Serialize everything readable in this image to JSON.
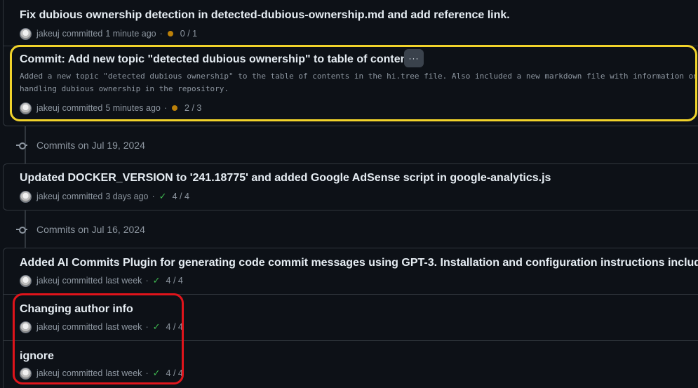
{
  "commits_top": [
    {
      "title": "Fix dubious ownership detection in detected-dubious-ownership.md and add reference link.",
      "author": "jakeuj",
      "committed_label": "committed",
      "time": "1 minute ago",
      "separator": "·",
      "status": "pending",
      "checks": "0 / 1"
    },
    {
      "title": "Commit: Add new topic \"detected dubious ownership\" to table of contents",
      "more_button": "···",
      "description": "Added a new topic \"detected dubious ownership\" to the table of contents in the hi.tree file. Also included a new markdown file with information on\nhandling dubious ownership in the repository.",
      "author": "jakeuj",
      "committed_label": "committed",
      "time": "5 minutes ago",
      "separator": "·",
      "status": "pending",
      "checks": "2 / 3"
    }
  ],
  "group_jul19": {
    "heading": "Commits on Jul 19, 2024",
    "commits": [
      {
        "title": "Updated DOCKER_VERSION to '241.18775' and added Google AdSense script in google-analytics.js",
        "author": "jakeuj",
        "committed_label": "committed",
        "time": "3 days ago",
        "separator": "·",
        "status": "success",
        "checks": "4 / 4"
      }
    ]
  },
  "group_jul16": {
    "heading": "Commits on Jul 16, 2024",
    "commits": [
      {
        "title": "Added AI Commits Plugin for generating code commit messages using GPT-3. Installation and configuration instructions included.",
        "author": "jakeuj",
        "committed_label": "committed",
        "time": "last week",
        "separator": "·",
        "status": "success",
        "checks": "4 / 4"
      },
      {
        "title": "Changing author info",
        "author": "jakeuj",
        "committed_label": "committed",
        "time": "last week",
        "separator": "·",
        "status": "success",
        "checks": "4 / 4"
      },
      {
        "title": "ignore",
        "author": "jakeuj",
        "committed_label": "committed",
        "time": "last week",
        "separator": "·",
        "status": "success",
        "checks": "4 / 4"
      }
    ]
  },
  "icons": {
    "pending": "status-pending-dot-icon",
    "success": "check-icon",
    "commit_node": "git-commit-icon"
  },
  "colors": {
    "background": "#0d1117",
    "pending": "#bb8009",
    "success": "#3fb950",
    "highlight_yellow": "#f1d32b",
    "highlight_red": "#e0141b"
  }
}
